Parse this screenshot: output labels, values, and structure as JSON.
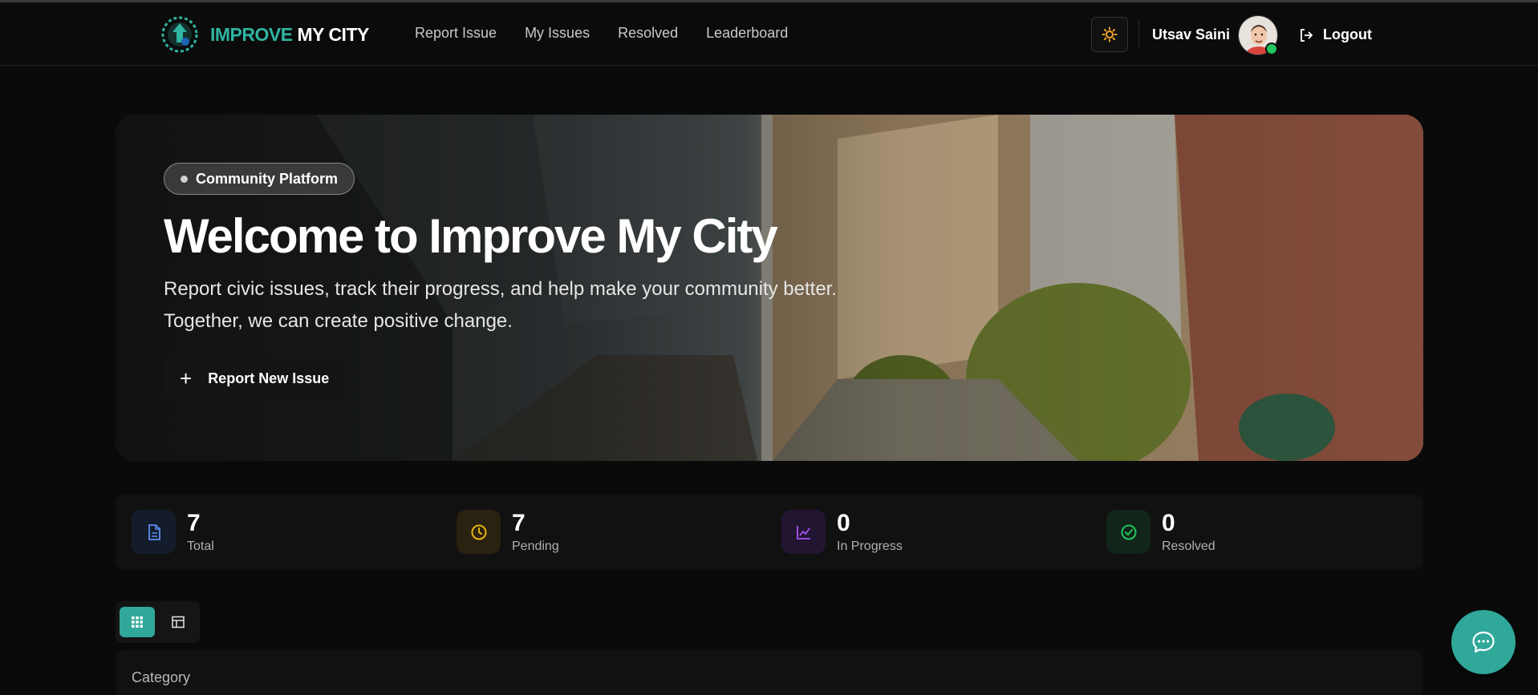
{
  "colors": {
    "accent": "#2fb5a2",
    "background": "#0a0a0a",
    "online": "#22c55e",
    "total_icon": "#5b8def",
    "pending_icon": "#eab308",
    "progress_icon": "#a855f7",
    "resolved_icon": "#22c55e"
  },
  "navbar": {
    "brand_part1": "IMPROVE",
    "brand_part2": "MY CITY",
    "links": [
      {
        "label": "Report Issue"
      },
      {
        "label": "My Issues"
      },
      {
        "label": "Resolved"
      },
      {
        "label": "Leaderboard"
      }
    ],
    "theme_icon": "sun-icon",
    "user_name": "Utsav Saini",
    "logout_label": "Logout"
  },
  "hero": {
    "badge": "Community Platform",
    "title": "Welcome to Improve My City",
    "subtitle": "Report civic issues, track their progress, and help make your community better. Together, we can create positive change.",
    "cta_label": "Report New Issue"
  },
  "stats": [
    {
      "value": "7",
      "label": "Total",
      "icon": "document-icon"
    },
    {
      "value": "7",
      "label": "Pending",
      "icon": "clock-icon"
    },
    {
      "value": "0",
      "label": "In Progress",
      "icon": "chart-line-icon"
    },
    {
      "value": "0",
      "label": "Resolved",
      "icon": "check-circle-icon"
    }
  ],
  "view_toggle": {
    "active": "grid"
  },
  "filters": {
    "title": "Category"
  },
  "chat": {
    "icon": "chat-icon"
  }
}
